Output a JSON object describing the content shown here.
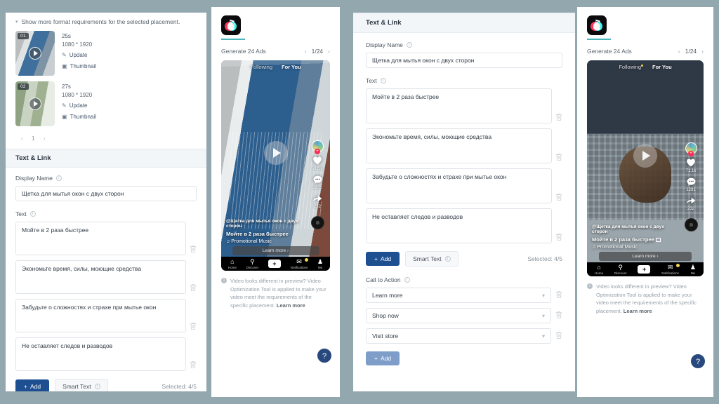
{
  "page": {
    "background_color": "#93a7af",
    "accent_color": "#1d4f91",
    "tiktok_teal": "#49b7bd"
  },
  "left_panel": {
    "hint": {
      "caret_icon": "chevron-down-icon",
      "text": "Show more format requirements for the selected placement."
    },
    "media_items": [
      {
        "index": "01",
        "duration": "25s",
        "dimensions": "1080 * 1920",
        "update_label": "Update",
        "thumbnail_label": "Thumbnail"
      },
      {
        "index": "02",
        "duration": "27s",
        "dimensions": "1080 * 1920",
        "update_label": "Update",
        "thumbnail_label": "Thumbnail"
      }
    ],
    "pager": {
      "prev": "‹",
      "current": "1",
      "next": "›"
    },
    "section_title": "Text & Link",
    "display_name": {
      "label": "Display Name",
      "value": "Щетка для мытья окон с двух сторон"
    },
    "text": {
      "label": "Text",
      "values": [
        "Мойте в 2 раза быстрее",
        "Экономьте время, силы, моющие средства",
        "Забудьте о сложностях и страхе при мытье окон",
        "Не оставляет следов и разводов"
      ]
    },
    "add_label": "Add",
    "smart_text_label": "Smart Text",
    "selected_label": "Selected: 4/5"
  },
  "preview_left": {
    "logo_name": "tiktok-logo",
    "generate_label": "Generate 24 Ads",
    "prev_icon": "chevron-left-icon",
    "counter": "1/24",
    "next_icon": "chevron-right-icon",
    "tabs": {
      "following": "Following",
      "for_you": "For You"
    },
    "caption": {
      "handle": "@Щетка для мытья окон с двух сторон",
      "headline": "Мойте в 2 раза быстрее",
      "music": "♫ Promotional Music"
    },
    "cta_label": "Learn more ›",
    "stats": {
      "likes": "71.1k",
      "comments": "1281",
      "shares": "232"
    },
    "nav": [
      "Home",
      "Discover",
      "Notifications",
      "Me"
    ],
    "notice": {
      "text": "Video looks different in preview? Video Optimization Tool is applied to make your video meet the requirements of the specific placement. ",
      "link": "Learn more"
    },
    "help_icon": "question-mark-icon"
  },
  "preview_right": {
    "logo_name": "tiktok-logo",
    "generate_label": "Generate 24 Ads",
    "prev_icon": "chevron-left-icon",
    "counter": "1/24",
    "next_icon": "chevron-right-icon",
    "tabs": {
      "following": "Following",
      "for_you": "For You"
    },
    "caption": {
      "handle": "@Щетка для мытья окон с двух сторон",
      "headline": "Мойте в 2 раза быстрее",
      "music": "♫ Promotional Music"
    },
    "cta_label": "Learn more ›",
    "stats": {
      "likes": "71.1k",
      "comments": "1281",
      "shares": "232"
    },
    "nav": [
      "Home",
      "Discover",
      "Notifications",
      "Me"
    ],
    "notice": {
      "text": "Video looks different in preview? Video Optimization Tool is applied to make your video meet the requirements of the specific placement. ",
      "link": "Learn more"
    },
    "help_icon": "question-mark-icon"
  },
  "right_panel": {
    "section_title": "Text & Link",
    "display_name": {
      "label": "Display Name",
      "value": "Щетка для мытья окон с двух сторон"
    },
    "text": {
      "label": "Text",
      "values": [
        "Мойте в 2 раза быстрее",
        "Экономьте время, силы, моющие средства",
        "Забудьте о сложностях и страхе при мытье окон",
        "Не оставляет следов и разводов"
      ]
    },
    "add_label": "Add",
    "smart_text_label": "Smart Text",
    "selected_label": "Selected: 4/5",
    "call_to_action": {
      "label": "Call to Action",
      "values": [
        "Learn more",
        "Shop now",
        "Visit store"
      ],
      "add_label": "Add"
    }
  }
}
